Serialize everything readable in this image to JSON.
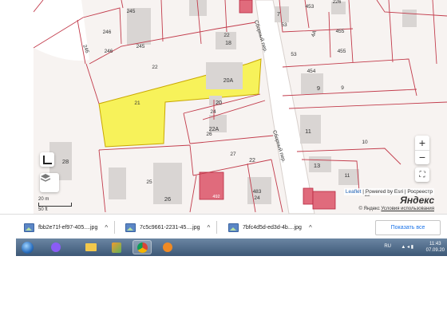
{
  "map": {
    "street_label": "Сборный пер.",
    "parcels": {
      "p245": "245",
      "p246a": "246",
      "p246b": "246",
      "p246c": "246",
      "p245b": "245",
      "p22a": "22",
      "p22b": "22",
      "p22c": "22",
      "p21": "21",
      "p20a": "20А",
      "p20": "20",
      "p24": "24",
      "p22A": "22А",
      "p26a": "26",
      "p27": "27",
      "p25": "25",
      "p26b": "26",
      "p28": "28",
      "p483": "483",
      "p24b": "24",
      "p492": "492",
      "p18": "18",
      "p7": "7",
      "p53a": "53",
      "p53b": "53",
      "p453": "453",
      "p226": "226",
      "p4A": "4А",
      "p455a": "455",
      "p455b": "455",
      "p454": "454",
      "p9a": "9",
      "p9b": "9",
      "p11a": "11",
      "p10": "10",
      "p13": "13",
      "p11b": "11",
      "p12": "12"
    },
    "highlight_color": "#f7f25a",
    "boundary_color": "#c23b4b",
    "zoom_in": "+",
    "zoom_out": "−",
    "scale_metric": "20 m",
    "scale_imperial": "50 ft",
    "attribution_leaflet": "Leaflet",
    "attribution_powered": "| Powered by Esri | Росреестр",
    "yandex_logo": "Яндекс",
    "yandex_copyright": "© Яндекс",
    "yandex_terms": "Условия использования"
  },
  "downloads": {
    "items": [
      {
        "name": "fbb2e71f-ef97-405....jpg"
      },
      {
        "name": "7c5c9661-2231-45....jpg"
      },
      {
        "name": "7bfc4d5d-ed3d-4b....jpg"
      }
    ],
    "show_all": "Показать все"
  },
  "taskbar": {
    "lang": "RU",
    "time": "11:43",
    "date": "07.09.20"
  }
}
